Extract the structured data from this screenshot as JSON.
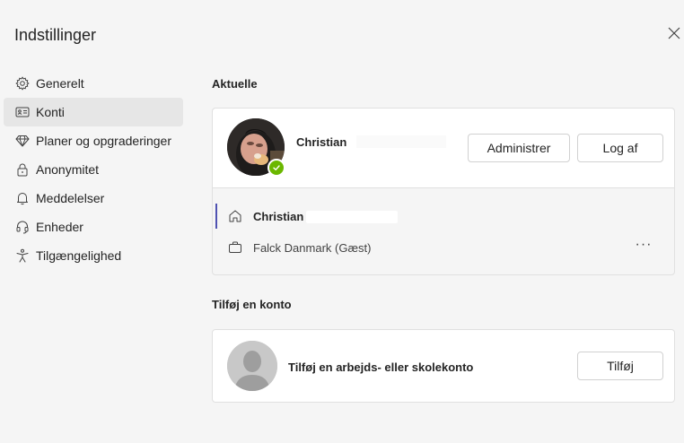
{
  "window": {
    "title": "Indstillinger"
  },
  "nav": {
    "items": [
      {
        "label": "Generelt",
        "icon": "gear-icon",
        "active": false
      },
      {
        "label": "Konti",
        "icon": "id-card-icon",
        "active": true
      },
      {
        "label": "Planer og opgraderinger",
        "icon": "diamond-icon",
        "active": false
      },
      {
        "label": "Anonymitet",
        "icon": "lock-icon",
        "active": false
      },
      {
        "label": "Meddelelser",
        "icon": "bell-icon",
        "active": false
      },
      {
        "label": "Enheder",
        "icon": "headset-icon",
        "active": false
      },
      {
        "label": "Tilgængelighed",
        "icon": "accessibility-icon",
        "active": false
      }
    ]
  },
  "current": {
    "heading": "Aktuelle",
    "account_name": "Christian",
    "status": "available",
    "manage_label": "Administrer",
    "signout_label": "Log af",
    "tenants": [
      {
        "label": "Christian",
        "icon": "home-icon",
        "selected": true
      },
      {
        "label": "Falck Danmark (Gæst)",
        "icon": "briefcase-icon",
        "selected": false
      }
    ],
    "more_label": "···"
  },
  "add_account": {
    "heading": "Tilføj en konto",
    "text": "Tilføj en arbejds- eller skolekonto",
    "button_label": "Tilføj"
  },
  "colors": {
    "accent": "#4f52b2",
    "status_available": "#6bb700",
    "background": "#f5f5f5"
  }
}
